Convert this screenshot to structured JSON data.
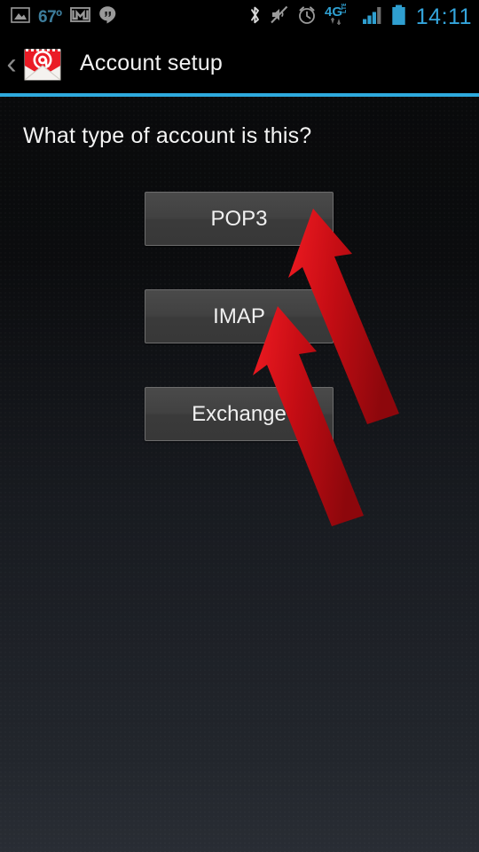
{
  "status_bar": {
    "temperature": "67º",
    "time": "14:11",
    "left_icons": [
      {
        "name": "photo-gallery-icon",
        "glyph": "image"
      },
      {
        "name": "gmail-icon",
        "glyph": "M-envelope"
      },
      {
        "name": "hangouts-icon",
        "glyph": "quote-bubble"
      }
    ],
    "right_icons": [
      {
        "name": "bluetooth-icon",
        "glyph": "bluetooth"
      },
      {
        "name": "mute-icon",
        "glyph": "speaker-muted"
      },
      {
        "name": "alarm-icon",
        "glyph": "alarm-clock"
      },
      {
        "name": "network-4g-lte-icon",
        "label": "4G",
        "superscript": "LTE"
      },
      {
        "name": "signal-bars-icon",
        "bars_filled": 3,
        "bars_total": 4
      },
      {
        "name": "battery-icon",
        "glyph": "battery-full"
      }
    ]
  },
  "action_bar": {
    "back_chevron": "‹",
    "app_icon_name": "email-at-envelope-icon",
    "title": "Account setup"
  },
  "content": {
    "prompt": "What type of account is this?",
    "account_type_buttons": [
      {
        "label": "POP3"
      },
      {
        "label": "IMAP"
      },
      {
        "label": "Exchange"
      }
    ]
  },
  "annotations": {
    "arrows": [
      {
        "name": "arrow-to-pop3",
        "points_to": "POP3"
      },
      {
        "name": "arrow-to-imap",
        "points_to": "IMAP"
      }
    ]
  },
  "colors": {
    "accent_blue": "#2eaade",
    "clock_blue": "#34a5dc",
    "temperature_blue": "#3d7d9c",
    "annotation_red": "#d6101a",
    "button_face": "#414141",
    "button_border": "#6d6d6d",
    "text_primary": "#f2f2f2"
  }
}
